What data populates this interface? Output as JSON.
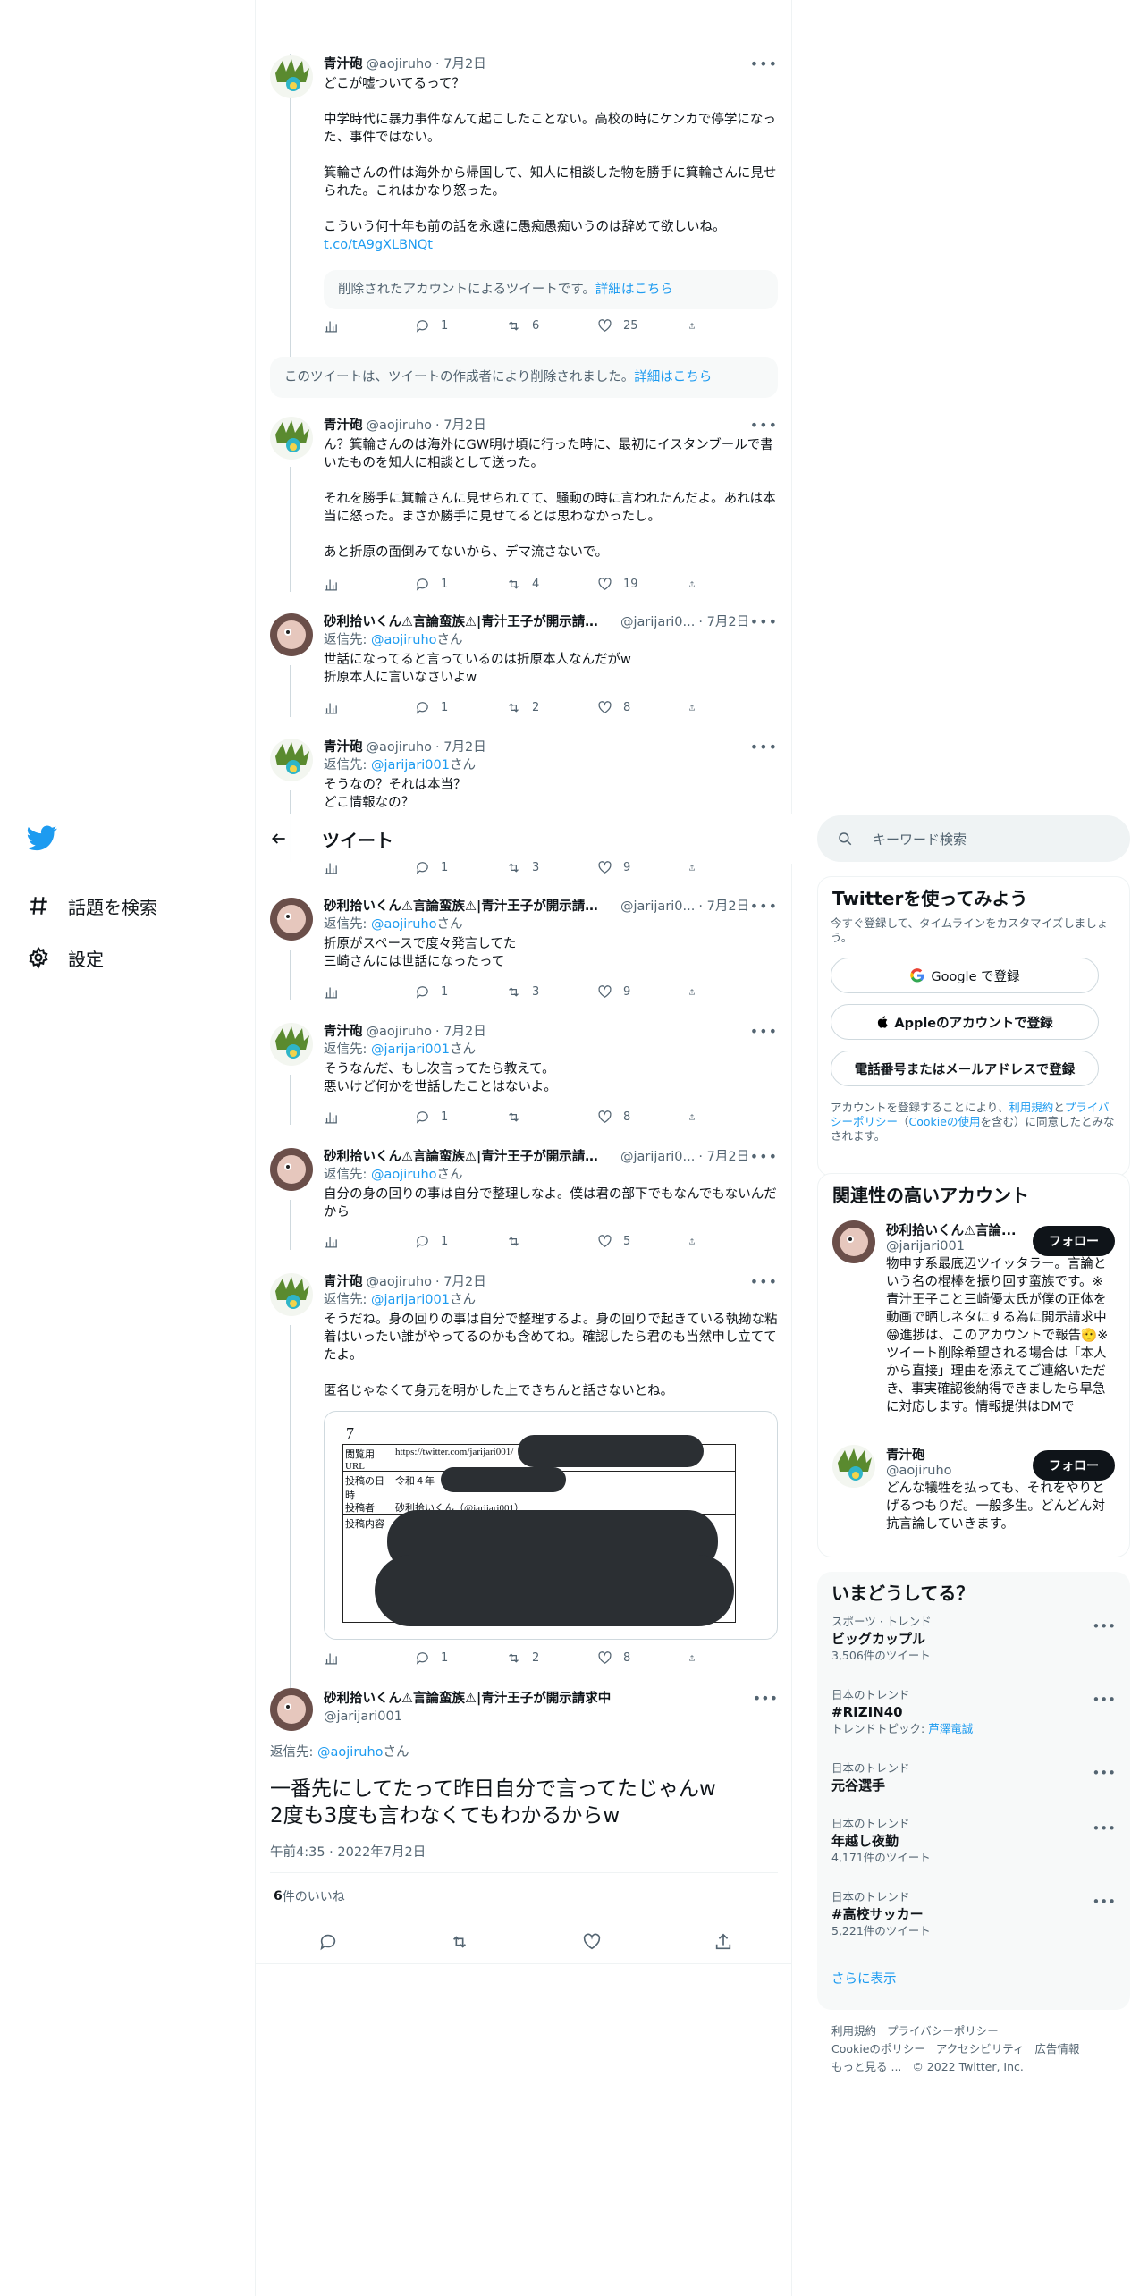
{
  "nav": {
    "items": [
      {
        "label": "話題を検索"
      },
      {
        "label": "設定"
      }
    ]
  },
  "header": {
    "title": "ツイート"
  },
  "tweets": [
    {
      "name": "青汁砲",
      "handle": "@aojiruho",
      "date": "· 7月2日",
      "text": "どこが嘘ついてるって？\n\n中学時代に暴力事件なんて起こしたことない。高校の時にケンカで停学になった、事件ではない。\n\n箕輪さんの件は海外から帰国して、知人に相談した物を勝手に箕輪さんに見せられた。これはかなり怒った。\n\nこういう何十年も前の話を永遠に愚痴愚痴いうのは辞めて欲しいね。",
      "link": "t.co/tA9gXLBNQt",
      "quote": "削除されたアカウントによるツイートです。",
      "quote_link": "詳細はこちら",
      "stats": {
        "reply": "1",
        "retweet": "6",
        "like": "25"
      }
    },
    {
      "deleted": "このツイートは、ツイートの作成者により削除されました。",
      "deleted_link": "詳細はこちら"
    },
    {
      "name": "青汁砲",
      "handle": "@aojiruho",
      "date": "· 7月2日",
      "text": "ん？箕輪さんのは海外にGW明け頃に行った時に、最初にイスタンブールで書いたものを知人に相談として送った。\n\nそれを勝手に箕輪さんに見せられてて、騒動の時に言われたんだよ。あれは本当に怒った。まさか勝手に見せてるとは思わなかったし。\n\nあと折原の面倒みてないから、デマ流さないで。",
      "stats": {
        "reply": "1",
        "retweet": "4",
        "like": "19"
      }
    },
    {
      "name": "砂利拾いくん⚠言論蛮族⚠|青汁王子が開示請求中",
      "handle": "@jarijari0...",
      "date": "· 7月2日",
      "reply_prefix": "返信先: ",
      "reply_to": "@aojiruho",
      "reply_suffix": "さん",
      "text": "世話になってると言っているのは折原本人なんだがw\n折原本人に言いなさいよw",
      "stats": {
        "reply": "1",
        "retweet": "2",
        "like": "8"
      }
    },
    {
      "name": "青汁砲",
      "handle": "@aojiruho",
      "date": "· 7月2日",
      "reply_prefix": "返信先: ",
      "reply_to": "@jarijari001",
      "reply_suffix": "さん",
      "text": "そうなの？それは本当？\nどこ情報なの？",
      "stats": {
        "reply": "1",
        "retweet": "3",
        "like": "9"
      }
    },
    {
      "name": "砂利拾いくん⚠言論蛮族⚠|青汁王子が開示請求中",
      "handle": "@jarijari0...",
      "date": "· 7月2日",
      "reply_prefix": "返信先: ",
      "reply_to": "@aojiruho",
      "reply_suffix": "さん",
      "text": "折原がスペースで度々発言してた\n三崎さんには世話になったって",
      "stats": {
        "reply": "1",
        "retweet": "3",
        "like": "9"
      }
    },
    {
      "name": "青汁砲",
      "handle": "@aojiruho",
      "date": "· 7月2日",
      "reply_prefix": "返信先: ",
      "reply_to": "@jarijari001",
      "reply_suffix": "さん",
      "text": "そうなんだ、もし次言ってたら教えて。\n悪いけど何かを世話したことはないよ。",
      "stats": {
        "reply": "1",
        "retweet": "",
        "like": "8"
      }
    },
    {
      "name": "砂利拾いくん⚠言論蛮族⚠|青汁王子が開示請求中",
      "handle": "@jarijari0...",
      "date": "· 7月2日",
      "reply_prefix": "返信先: ",
      "reply_to": "@aojiruho",
      "reply_suffix": "さん",
      "text": "自分の身の回りの事は自分で整理しなよ。僕は君の部下でもなんでもないんだから",
      "stats": {
        "reply": "1",
        "retweet": "",
        "like": "5"
      }
    },
    {
      "name": "青汁砲",
      "handle": "@aojiruho",
      "date": "· 7月2日",
      "reply_prefix": "返信先: ",
      "reply_to": "@jarijari001",
      "reply_suffix": "さん",
      "text": "そうだね。身の回りの事は自分で整理するよ。身の回りで起きている執拗な粘着はいったい誰がやってるのかも含めてね。確認したら君のも当然申し立ててたよ。\n\n匿名じゃなくて身元を明かした上できちんと話さないとね。",
      "doc": {
        "num": "7",
        "r1": "閲覧用URL",
        "r1v": "https://twitter.com/jarijari001/",
        "r2": "投稿の日時",
        "r2v": "令和４年",
        "r3": "投稿者",
        "r3v": "砂利拾いくん（@jarijari001）",
        "r4": "投稿内容"
      },
      "stats": {
        "reply": "1",
        "retweet": "2",
        "like": "8"
      }
    }
  ],
  "main_tweet": {
    "name": "砂利拾いくん⚠言論蛮族⚠|青汁王子が開示請求中",
    "handle": "@jarijari001",
    "reply_prefix": "返信先: ",
    "reply_to": "@aojiruho",
    "reply_suffix": "さん",
    "text": "一番先にしてたって昨日自分で言ってたじゃんw\n2度も3度も言わなくてもわかるからw",
    "timestamp": "午前4:35 · 2022年7月2日",
    "likes_count": "6",
    "likes_label": " 件のいいね"
  },
  "search": {
    "placeholder": "キーワード検索"
  },
  "signup": {
    "title": "Twitterを使ってみよう",
    "subtitle": "今すぐ登録して、タイムラインをカスタマイズしましょう。",
    "google": "Google で登録",
    "apple": "Appleのアカウントで登録",
    "phone": "電話番号またはメールアドレスで登録",
    "legal_1": "アカウントを登録することにより、",
    "legal_terms": "利用規約",
    "legal_2": "と",
    "legal_privacy": "プライバシーポリシー",
    "legal_3": "（",
    "legal_cookie": "Cookieの使用",
    "legal_4": "を含む）に同意したとみなされます。"
  },
  "related": {
    "title": "関連性の高いアカウント",
    "accounts": [
      {
        "name": "砂利拾いくん⚠言論...",
        "handle": "@jarijari001",
        "follow": "フォロー",
        "bio": "物申す系最底辺ツイッタラー。言論という名の棍棒を振り回す蛮族です。※青汁王子こと三崎優太氏が僕の正体を動画で晒しネタにする為に開示請求中😁進捗は、このアカウントで報告🫡※ツイート削除希望される場合は「本人から直接」理由を添えてご連絡いただき、事実確認後納得できましたら早急に対応します。情報提供はDMで"
      },
      {
        "name": "青汁砲",
        "handle": "@aojiruho",
        "follow": "フォロー",
        "bio": "どんな犠牲を払っても、それをやりとげるつもりだ。一般多生。どんどん対抗言論していきます。"
      }
    ]
  },
  "trends": {
    "title": "いまどうしてる？",
    "items": [
      {
        "meta": "スポーツ · トレンド",
        "title": "ビッグカップル",
        "count": "3,506件のツイート"
      },
      {
        "meta": "日本のトレンド",
        "title": "#RIZIN40",
        "topic_prefix": "トレンドトピック: ",
        "topic": "芦澤竜誠"
      },
      {
        "meta": "日本のトレンド",
        "title": "元谷選手"
      },
      {
        "meta": "日本のトレンド",
        "title": "年越し夜勤",
        "count": "4,171件のツイート"
      },
      {
        "meta": "日本のトレンド",
        "title": "#高校サッカー",
        "count": "5,221件のツイート"
      }
    ],
    "show_more": "さらに表示"
  },
  "footer": {
    "links": [
      "利用規約",
      "プライバシーポリシー",
      "Cookieのポリシー",
      "アクセシビリティ",
      "広告情報",
      "もっと見る ..."
    ],
    "copyright": "© 2022 Twitter, Inc."
  },
  "colors": {
    "accent": "#1d9bf0",
    "text": "#0f1419",
    "muted": "#536471",
    "border": "#eff3f4"
  }
}
